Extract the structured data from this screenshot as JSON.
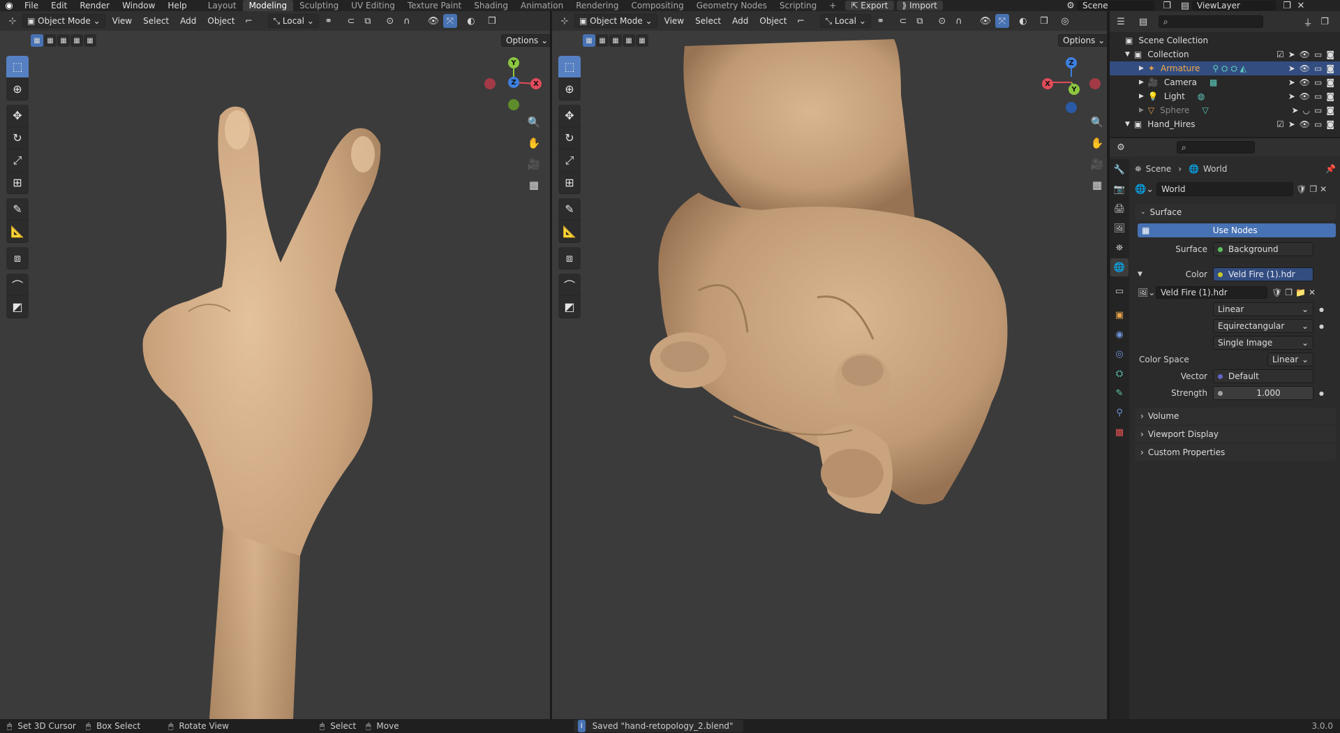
{
  "topbar": {
    "menus": [
      "File",
      "Edit",
      "Render",
      "Window",
      "Help"
    ],
    "workspaces": [
      "Layout",
      "Modeling",
      "Sculpting",
      "UV Editing",
      "Texture Paint",
      "Shading",
      "Animation",
      "Rendering",
      "Compositing",
      "Geometry Nodes",
      "Scripting"
    ],
    "active_workspace": "Modeling",
    "add_tab": "+",
    "export_label": "Export",
    "import_label": "Import",
    "scene": "Scene",
    "view_layer": "ViewLayer"
  },
  "viewport_left": {
    "mode": "Object Mode",
    "menus": [
      "View",
      "Select",
      "Add",
      "Object"
    ],
    "orientation": "Local",
    "options": "Options",
    "gizmo": {
      "y": "Y",
      "z": "Z",
      "x": "X"
    }
  },
  "viewport_right": {
    "mode": "Object Mode",
    "menus": [
      "View",
      "Select",
      "Add",
      "Object"
    ],
    "orientation": "Local",
    "options": "Options",
    "gizmo": {
      "z": "Z",
      "x": "X",
      "y": "Y"
    }
  },
  "outliner": {
    "root": "Scene Collection",
    "items": [
      {
        "name": "Collection"
      },
      {
        "name": "Armature"
      },
      {
        "name": "Camera"
      },
      {
        "name": "Light"
      },
      {
        "name": "Sphere"
      },
      {
        "name": "Hand_Hires"
      }
    ]
  },
  "properties": {
    "breadcrumb_scene": "Scene",
    "breadcrumb_world": "World",
    "world_name": "World",
    "surface_section": "Surface",
    "use_nodes": "Use Nodes",
    "surface_label": "Surface",
    "surface_value": "Background",
    "color_label": "Color",
    "color_value": "Veld Fire (1).hdr",
    "image_name": "Veld Fire (1).hdr",
    "interpolation": "Linear",
    "projection": "Equirectangular",
    "source": "Single Image",
    "color_space_label": "Color Space",
    "color_space_value": "Linear",
    "vector_label": "Vector",
    "vector_value": "Default",
    "strength_label": "Strength",
    "strength_value": "1.000",
    "volume": "Volume",
    "viewport_display": "Viewport Display",
    "custom_properties": "Custom Properties"
  },
  "status": {
    "set_cursor": "Set 3D Cursor",
    "box_select": "Box Select",
    "rotate_view": "Rotate View",
    "select": "Select",
    "move": "Move",
    "saved_message": "Saved \"hand-retopology_2.blend\"",
    "version": "3.0.0"
  },
  "colors": {
    "accent": "#4772b3",
    "viewport_bg": "#3b3b3b",
    "skin": "#c5a280",
    "gizmo_x": "#e04b5a",
    "gizmo_y": "#8cc63f",
    "gizmo_z": "#3d7fe0"
  }
}
